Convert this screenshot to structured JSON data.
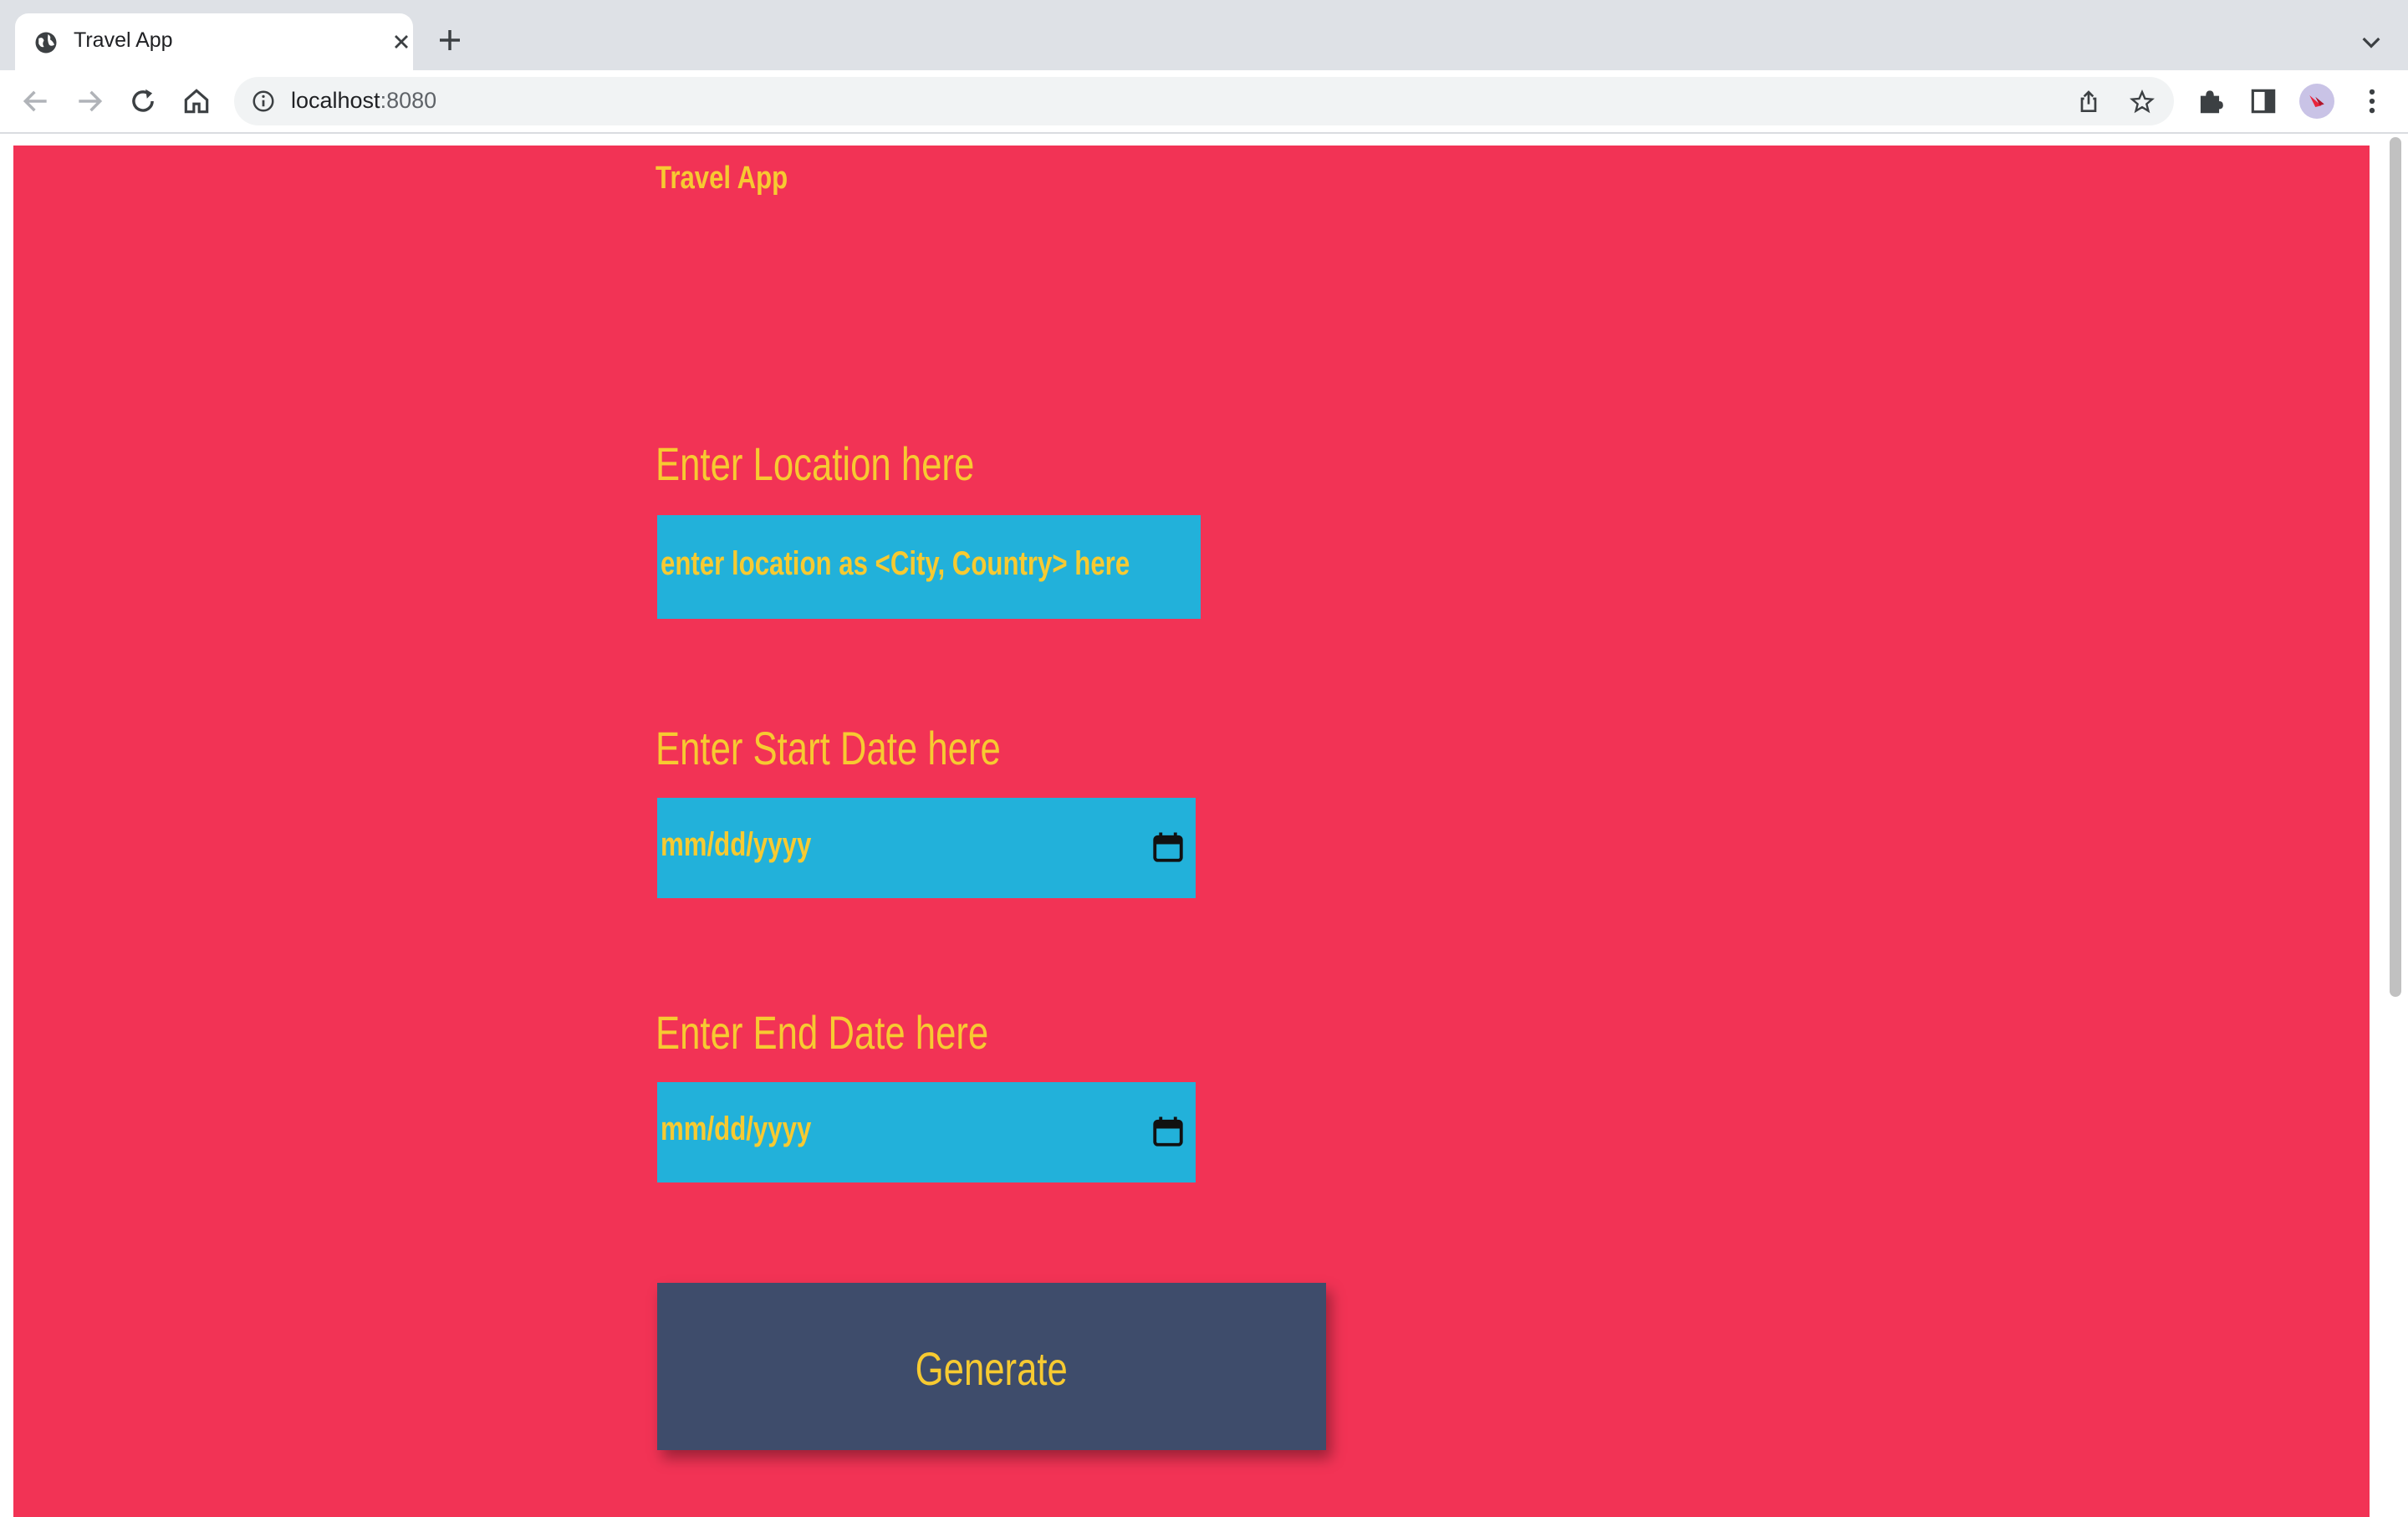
{
  "browser": {
    "tab_title": "Travel App",
    "url_host": "localhost",
    "url_port": ":8080",
    "icons": [
      "globe-icon",
      "close-icon",
      "plus-icon",
      "chevron-down-icon",
      "back-icon",
      "forward-icon",
      "reload-icon",
      "home-icon",
      "info-icon",
      "share-icon",
      "star-icon",
      "puzzle-icon",
      "sidebar-icon",
      "avatar",
      "kebab-menu-icon"
    ]
  },
  "app": {
    "title": "Travel App",
    "background_color": "#f23355",
    "accent_color": "#f7ca31",
    "input_color": "#22b1da",
    "button_color": "#3e4c6b",
    "location": {
      "label": "Enter Location here",
      "placeholder": "enter location as <City, Country> here"
    },
    "start_date": {
      "label": "Enter Start Date here",
      "placeholder": "mm/dd/yyyy"
    },
    "end_date": {
      "label": "Enter End Date here",
      "placeholder": "mm/dd/yyyy"
    },
    "generate_label": "Generate"
  }
}
